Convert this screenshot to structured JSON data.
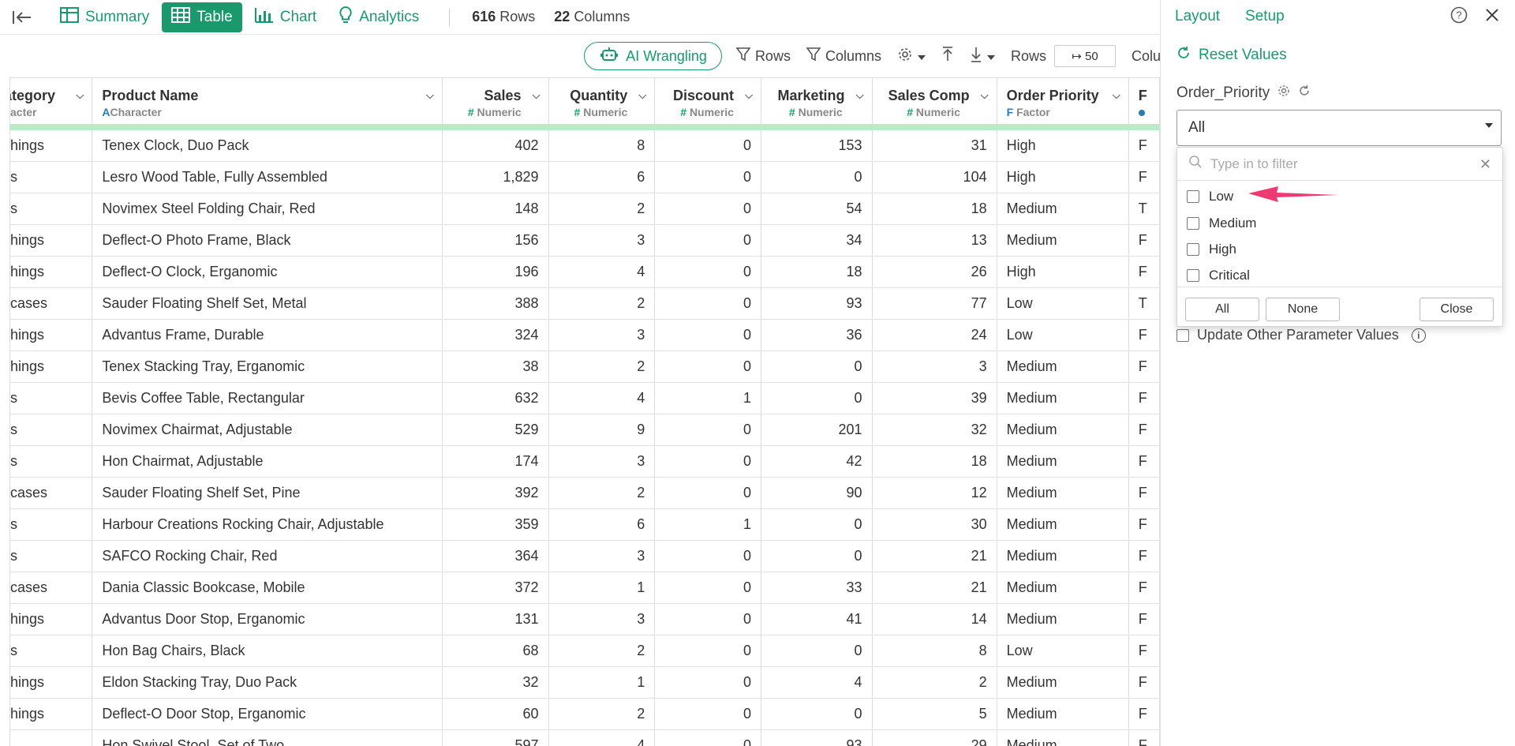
{
  "nav": {
    "tabs": [
      {
        "label": "Summary",
        "icon": "table-grid-icon"
      },
      {
        "label": "Table",
        "icon": "table-grid-icon"
      },
      {
        "label": "Chart",
        "icon": "bar-chart-icon"
      },
      {
        "label": "Analytics",
        "icon": "lightbulb-icon"
      }
    ],
    "active_tab": "Table",
    "rows_count": "616",
    "rows_word": "Rows",
    "columns_count": "22",
    "columns_word": "Columns"
  },
  "toolbar": {
    "ai_label": "AI Wrangling",
    "rows_filter_label": "Rows",
    "columns_filter_label": "Columns",
    "rows_label": "Rows",
    "rows_value": "↦ 50",
    "columns_cut_label": "Colu"
  },
  "table": {
    "headers": [
      {
        "name": "Category",
        "type": "Character",
        "symbol": "A",
        "display_name": "ategory",
        "display_type": "acter"
      },
      {
        "name": "Product Name",
        "type": "Character",
        "symbol": "A"
      },
      {
        "name": "Sales",
        "type": "Numeric",
        "symbol": "#"
      },
      {
        "name": "Quantity",
        "type": "Numeric",
        "symbol": "#"
      },
      {
        "name": "Discount",
        "type": "Numeric",
        "symbol": "#"
      },
      {
        "name": "Marketing",
        "type": "Numeric",
        "symbol": "#"
      },
      {
        "name": "Sales Comp",
        "type": "Numeric",
        "symbol": "#"
      },
      {
        "name": "Order Priority",
        "type": "Factor",
        "symbol": "F"
      },
      {
        "name": "F",
        "type": "",
        "symbol": ""
      }
    ],
    "rows": [
      [
        "hings",
        "Tenex Clock, Duo Pack",
        "402",
        "8",
        "0",
        "153",
        "31",
        "High",
        "F"
      ],
      [
        "s",
        "Lesro Wood Table, Fully Assembled",
        "1,829",
        "6",
        "0",
        "0",
        "104",
        "High",
        "F"
      ],
      [
        "s",
        "Novimex Steel Folding Chair, Red",
        "148",
        "2",
        "0",
        "54",
        "18",
        "Medium",
        "T"
      ],
      [
        "hings",
        "Deflect-O Photo Frame, Black",
        "156",
        "3",
        "0",
        "34",
        "13",
        "Medium",
        "F"
      ],
      [
        "hings",
        "Deflect-O Clock, Erganomic",
        "196",
        "4",
        "0",
        "18",
        "26",
        "High",
        "F"
      ],
      [
        "cases",
        "Sauder Floating Shelf Set, Metal",
        "388",
        "2",
        "0",
        "93",
        "77",
        "Low",
        "T"
      ],
      [
        "hings",
        "Advantus Frame, Durable",
        "324",
        "3",
        "0",
        "36",
        "24",
        "Low",
        "F"
      ],
      [
        "hings",
        "Tenex Stacking Tray, Erganomic",
        "38",
        "2",
        "0",
        "0",
        "3",
        "Medium",
        "F"
      ],
      [
        "s",
        "Bevis Coffee Table, Rectangular",
        "632",
        "4",
        "1",
        "0",
        "39",
        "Medium",
        "F"
      ],
      [
        "s",
        "Novimex Chairmat, Adjustable",
        "529",
        "9",
        "0",
        "201",
        "32",
        "Medium",
        "F"
      ],
      [
        "s",
        "Hon Chairmat, Adjustable",
        "174",
        "3",
        "0",
        "42",
        "18",
        "Medium",
        "F"
      ],
      [
        "cases",
        "Sauder Floating Shelf Set, Pine",
        "392",
        "2",
        "0",
        "90",
        "12",
        "Medium",
        "F"
      ],
      [
        "s",
        "Harbour Creations Rocking Chair, Adjustable",
        "359",
        "6",
        "1",
        "0",
        "30",
        "Medium",
        "F"
      ],
      [
        "s",
        "SAFCO Rocking Chair, Red",
        "364",
        "3",
        "0",
        "0",
        "21",
        "Medium",
        "F"
      ],
      [
        "cases",
        "Dania Classic Bookcase, Mobile",
        "372",
        "1",
        "0",
        "33",
        "21",
        "Medium",
        "F"
      ],
      [
        "hings",
        "Advantus Door Stop, Erganomic",
        "131",
        "3",
        "0",
        "41",
        "14",
        "Medium",
        "F"
      ],
      [
        "s",
        "Hon Bag Chairs, Black",
        "68",
        "2",
        "0",
        "0",
        "8",
        "Low",
        "F"
      ],
      [
        "hings",
        "Eldon Stacking Tray, Duo Pack",
        "32",
        "1",
        "0",
        "4",
        "2",
        "Medium",
        "F"
      ],
      [
        "hings",
        "Deflect-O Door Stop, Erganomic",
        "60",
        "2",
        "0",
        "0",
        "5",
        "Medium",
        "F"
      ],
      [
        "",
        "Hon Swivel Stool, Set of Two",
        "597",
        "4",
        "0",
        "93",
        "29",
        "Medium",
        "F"
      ]
    ]
  },
  "panel": {
    "tab_layout": "Layout",
    "tab_setup": "Setup",
    "reset_label": "Reset Values",
    "param_name": "Order_Priority",
    "select_value": "All",
    "filter_placeholder": "Type in to filter",
    "options": [
      "Low",
      "Medium",
      "High",
      "Critical"
    ],
    "btn_all": "All",
    "btn_none": "None",
    "btn_close": "Close",
    "update_label": "Update Other Parameter Values"
  },
  "colors": {
    "accent": "#1a9a6c",
    "header_bar": "#b8ebc8",
    "arrow": "#ee3a72"
  }
}
